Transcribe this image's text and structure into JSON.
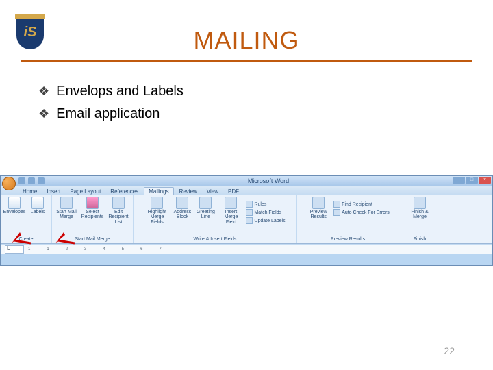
{
  "slide": {
    "title": "MAILING",
    "logo_letters": "iS",
    "bullets": [
      "Envelops and Labels",
      "Email application"
    ],
    "page_number": "22"
  },
  "word": {
    "app_title": "Microsoft Word",
    "tabs": [
      "Home",
      "Insert",
      "Page Layout",
      "References",
      "Mailings",
      "Review",
      "View",
      "PDF"
    ],
    "active_tab_index": 4,
    "groups": {
      "create": {
        "label": "Create",
        "buttons": [
          "Envelopes",
          "Labels"
        ]
      },
      "start": {
        "label": "Start Mail Merge",
        "buttons": [
          "Start Mail Merge",
          "Select Recipients",
          "Edit Recipient List"
        ]
      },
      "write": {
        "label": "Write & Insert Fields",
        "buttons": [
          "Highlight Merge Fields",
          "Address Block",
          "Greeting Line",
          "Insert Merge Field"
        ],
        "lines": [
          "Rules",
          "Match Fields",
          "Update Labels"
        ]
      },
      "preview": {
        "label": "Preview Results",
        "buttons": [
          "Preview Results"
        ],
        "lines": [
          "Find Recipient",
          "Auto Check For Errors"
        ]
      },
      "finish": {
        "label": "Finish",
        "buttons": [
          "Finish & Merge"
        ]
      }
    },
    "ruler_ticks": [
      "1",
      "",
      "1",
      "",
      "2",
      "",
      "3",
      "",
      "4",
      "",
      "5",
      "",
      "6",
      "",
      "7"
    ]
  }
}
